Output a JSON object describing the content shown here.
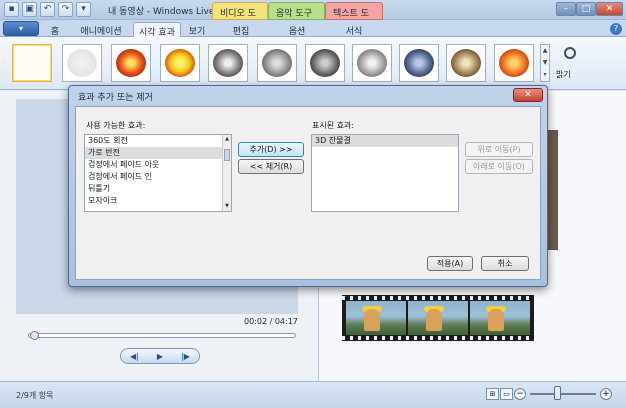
{
  "window": {
    "title": "내 동영상 - Windows Live 무비 ...",
    "context_tabs": [
      "비디오 도구",
      "음악 도구",
      "텍스트 도구"
    ],
    "controls": [
      "–",
      "□",
      "✕"
    ]
  },
  "ribbon": {
    "app_button": "▾",
    "tabs": [
      "홈",
      "애니메이션",
      "시각 효과",
      "보기",
      "편집",
      "옵션",
      "서식"
    ],
    "active_tab": "시각 효과",
    "brightness_label": "밝기",
    "effect_thumbs": [
      "none",
      "blur",
      "color",
      "warm",
      "bw-1",
      "bw-2",
      "bw-3",
      "bw-4",
      "cyanotype",
      "sepia",
      "orange"
    ],
    "help": "?"
  },
  "preview": {
    "timecode": "00:02 / 04:17",
    "progress": 0.01,
    "buttons": [
      "◀|",
      "▶",
      "|▶"
    ]
  },
  "status": {
    "item_count": "2/9개 항목",
    "zoom_minus": "−",
    "zoom_plus": "+",
    "zoom_level": 0.4
  },
  "dialog": {
    "title": "효과 추가 또는 제거",
    "close": "✕",
    "available_label": "사용 가능한 효과:",
    "available_items": [
      "360도 회전",
      "가로 반전",
      "검정에서 페이드 아웃",
      "검정에서 페이드 인",
      "뒤틀기",
      "모자이크"
    ],
    "available_selected": 1,
    "displayed_label": "표시된 효과:",
    "displayed_items": [
      "3D 잔물결"
    ],
    "add_button": "추가(D) >>",
    "remove_button": "<< 제거(R)",
    "move_up_button": "위로 이동(P)",
    "move_down_button": "아래로 이동(O)",
    "apply_button": "적용(A)",
    "cancel_button": "취소"
  }
}
